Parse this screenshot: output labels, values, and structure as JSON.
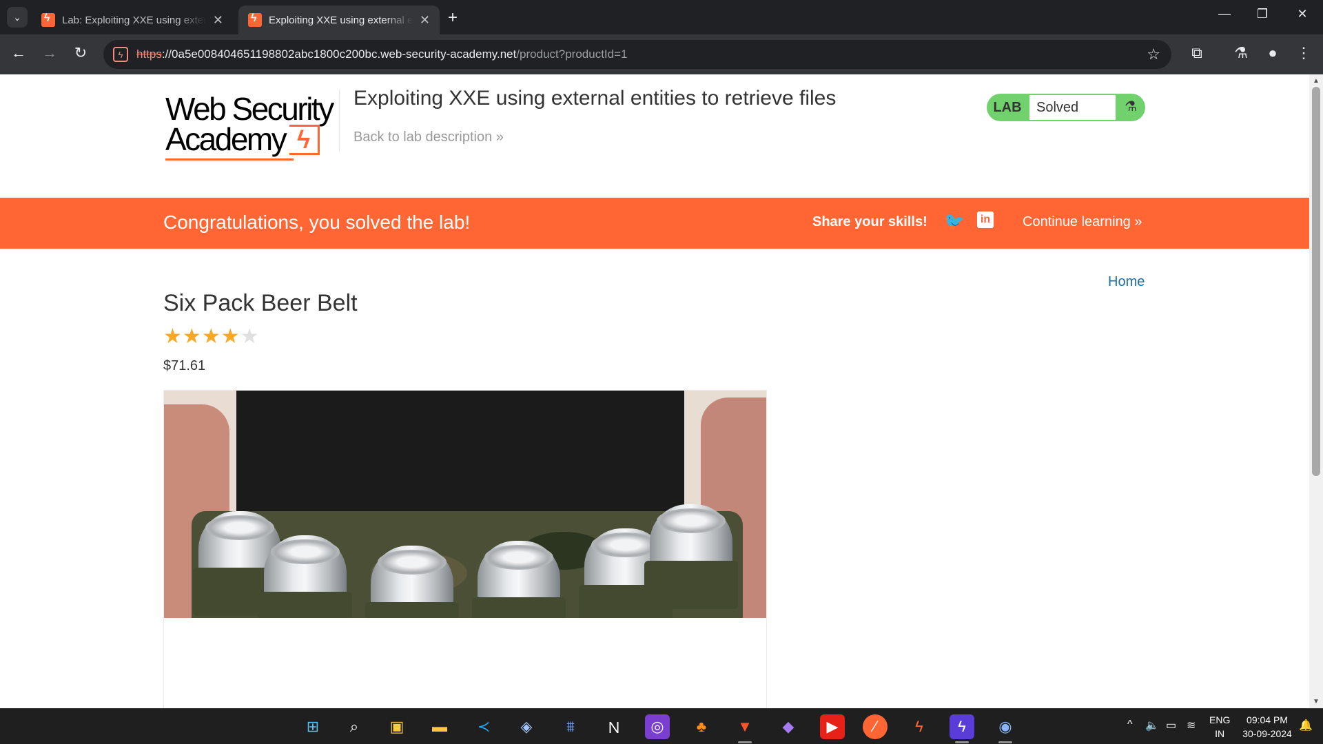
{
  "browser": {
    "tabs": [
      {
        "title": "Lab: Exploiting XXE using external entities to retrieve files",
        "active": false
      },
      {
        "title": "Exploiting XXE using external entities to retrieve files",
        "active": true
      }
    ],
    "url": {
      "scheme": "https",
      "host": "://0a5e008404651198802abc1800c200bc.web-security-academy.net",
      "path": "/product?productId=1"
    },
    "icons": {
      "tab_list": "chevron-down-icon",
      "back": "arrow-left-icon",
      "forward": "arrow-right-icon",
      "reload": "reload-icon",
      "not_secure": "not-secure-icon",
      "bookmark": "star-icon",
      "extensions": "puzzle-icon",
      "labs": "flask-icon",
      "profile": "person-icon",
      "menu": "kebab-menu-icon"
    }
  },
  "header": {
    "logo_line1": "Web Security",
    "logo_line2": "Academy",
    "lab_title": "Exploiting XXE using external entities to retrieve files",
    "back_link": "Back to lab description »",
    "lab_status": {
      "label": "LAB",
      "status": "Solved",
      "color": "#70d16d"
    }
  },
  "banner": {
    "message": "Congratulations, you solved the lab!",
    "share": "Share your skills!",
    "continue": "Continue learning »",
    "color": "#ff6633"
  },
  "nav": {
    "home": "Home"
  },
  "product": {
    "title": "Six Pack Beer Belt",
    "rating": 4,
    "rating_max": 5,
    "price": "$71.61"
  },
  "taskbar": {
    "apps": [
      "windows-start-icon",
      "search-icon",
      "store-icon",
      "file-explorer-icon",
      "vscode-icon",
      "virtualbox-icon",
      "wireshark-icon",
      "notion-icon",
      "podcast-icon",
      "fl-studio-icon",
      "brave-icon",
      "obsidian-icon",
      "youtube-icon",
      "burp-icon",
      "portswigger-icon",
      "vpn-icon",
      "chrome-icon"
    ],
    "language": "ENG",
    "region": "IN",
    "time": "09:04 PM",
    "date": "30-09-2024"
  }
}
